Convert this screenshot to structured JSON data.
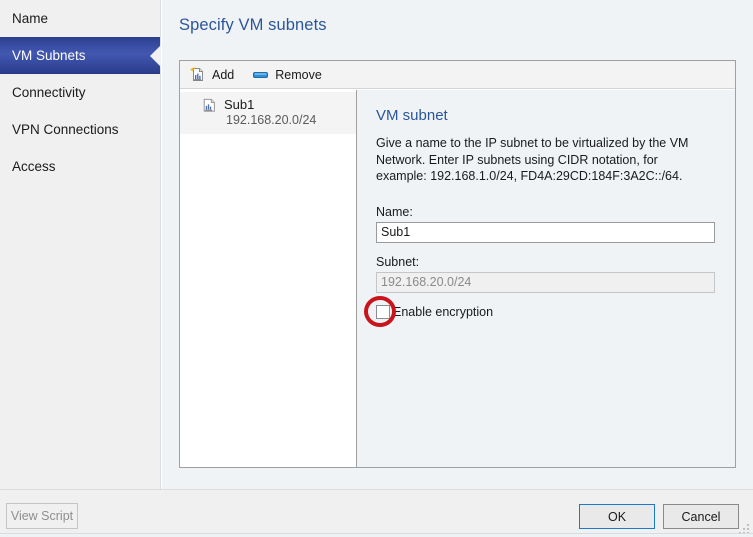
{
  "sidebar": {
    "items": [
      {
        "label": "Name",
        "selected": false
      },
      {
        "label": "VM Subnets",
        "selected": true
      },
      {
        "label": "Connectivity",
        "selected": false
      },
      {
        "label": "VPN Connections",
        "selected": false
      },
      {
        "label": "Access",
        "selected": false
      }
    ]
  },
  "page": {
    "title": "Specify VM subnets"
  },
  "toolbar": {
    "add_label": "Add",
    "add_icon": "add-subnet-icon",
    "remove_label": "Remove",
    "remove_icon": "remove-subnet-icon"
  },
  "list": {
    "rows": [
      {
        "icon": "subnet-icon",
        "name": "Sub1",
        "subnet": "192.168.20.0/24",
        "selected": true
      }
    ]
  },
  "detail": {
    "title": "VM subnet",
    "description": "Give a name to the IP subnet to be virtualized by the VM Network. Enter IP subnets using CIDR notation, for example: 192.168.1.0/24, FD4A:29CD:184F:3A2C::/64.",
    "name_label": "Name:",
    "name_value": "Sub1",
    "name_placeholder": "",
    "subnet_label": "Subnet:",
    "subnet_value": "192.168.20.0/24",
    "subnet_placeholder": "",
    "subnet_disabled": true,
    "encryption_label": "Enable encryption",
    "encryption_checked": false
  },
  "annotation": {
    "shape": "red-circle-highlight",
    "target": "enable-encryption-checkbox",
    "color": "#c9141b"
  },
  "footer": {
    "view_script_label": "View Script",
    "view_script_disabled": true,
    "ok_label": "OK",
    "cancel_label": "Cancel"
  },
  "colors": {
    "accent_blue": "#2a5699",
    "selection_blue": "#33479c",
    "focus_blue": "#1c7ac9",
    "annotation_red": "#c9141b",
    "panel_bg": "#f0f3f6"
  }
}
